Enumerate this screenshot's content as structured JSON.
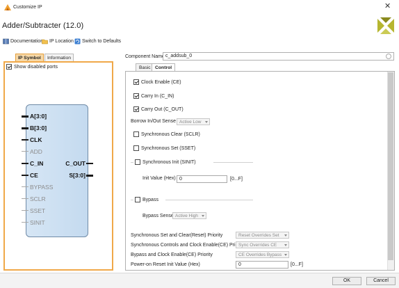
{
  "window": {
    "title": "Customize IP",
    "close_glyph": "✕"
  },
  "header": {
    "title": "Adder/Subtracter (12.0)",
    "links": [
      {
        "label": "Documentation",
        "icon": "book-icon"
      },
      {
        "label": "IP Location",
        "icon": "folder-icon"
      },
      {
        "label": "Switch to Defaults",
        "icon": "refresh-icon"
      }
    ]
  },
  "left_tabs": [
    "IP Symbol",
    "Information"
  ],
  "left_panel": {
    "show_disabled_label": "Show disabled ports",
    "show_disabled_checked": true,
    "ports_left": [
      {
        "name": "A[3:0]",
        "enabled": true,
        "bus": true
      },
      {
        "name": "B[3:0]",
        "enabled": true,
        "bus": true
      },
      {
        "name": "CLK",
        "enabled": true,
        "bus": false
      },
      {
        "name": "ADD",
        "enabled": false,
        "bus": false
      },
      {
        "name": "C_IN",
        "enabled": true,
        "bus": false
      },
      {
        "name": "CE",
        "enabled": true,
        "bus": false
      },
      {
        "name": "BYPASS",
        "enabled": false,
        "bus": false
      },
      {
        "name": "SCLR",
        "enabled": false,
        "bus": false
      },
      {
        "name": "SSET",
        "enabled": false,
        "bus": false
      },
      {
        "name": "SINIT",
        "enabled": false,
        "bus": false
      }
    ],
    "ports_right": [
      {
        "name": "C_OUT",
        "enabled": true,
        "bus": false
      },
      {
        "name": "S[3:0]",
        "enabled": true,
        "bus": true
      }
    ]
  },
  "component": {
    "label": "Component Name",
    "value": "c_addsub_0"
  },
  "right_tabs": [
    "Basic",
    "Control"
  ],
  "control": {
    "clock_enable": {
      "label": "Clock Enable (CE)",
      "checked": true
    },
    "carry_in": {
      "label": "Carry In (C_IN)",
      "checked": true
    },
    "carry_out": {
      "label": "Carry Out (C_OUT)",
      "checked": true
    },
    "borrow_sense": {
      "label": "Borrow In/Out Sense",
      "value": "Active Low"
    },
    "sync_clear": {
      "label": "Synchronous Clear (SCLR)",
      "checked": false
    },
    "sync_set": {
      "label": "Synchronous Set (SSET)",
      "checked": false
    },
    "sync_init": {
      "label": "Synchronous Init (SINIT)",
      "checked": false
    },
    "init_value": {
      "label": "Init Value (Hex)",
      "value": "0",
      "range": "[0...F]"
    },
    "bypass": {
      "label": "Bypass",
      "checked": false
    },
    "bypass_sense": {
      "label": "Bypass Sense",
      "value": "Active High"
    },
    "sync_priority": {
      "label": "Synchronous Set and Clear(Reset) Priority",
      "value": "Reset Overrides Set"
    },
    "ce_priority": {
      "label": "Synchronous Controls and Clock Enable(CE) Priority",
      "value": "Sync Overrides CE"
    },
    "bypass_priority": {
      "label": "Bypass and Clock Enable(CE) Priority",
      "value": "CE Overrides Bypass"
    },
    "power_on": {
      "label": "Power-on Reset Init Value (Hex)",
      "value": "0",
      "range": "[0...F]"
    }
  },
  "footer": {
    "ok": "OK",
    "cancel": "Cancel"
  },
  "colors": {
    "accent": "#f0a848",
    "block_fill": "#c9dcef",
    "disabled_text": "#8c8c8c"
  }
}
